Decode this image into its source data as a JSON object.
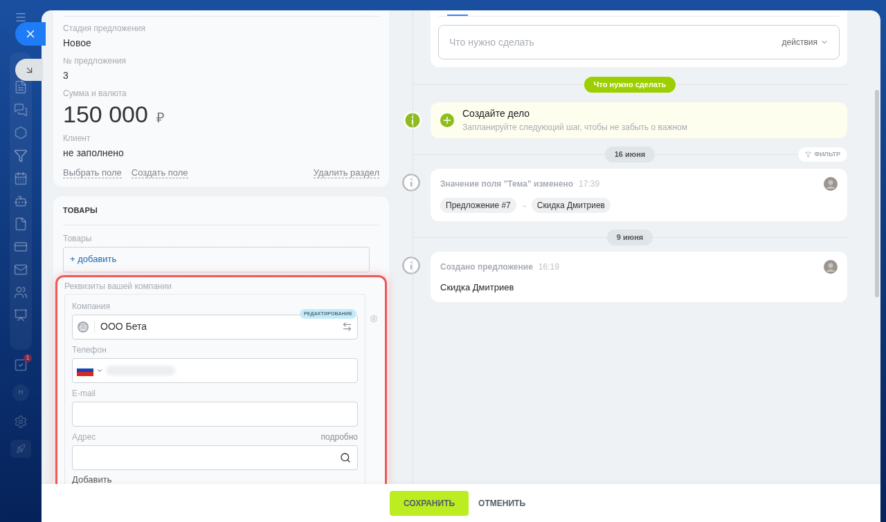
{
  "sidebar": {
    "task_badge": "1",
    "avatar_letter": "Н"
  },
  "details": {
    "fields": [
      {
        "label": "Стадия предложения",
        "value": "Новое",
        "kind": "text"
      },
      {
        "label": "№ предложения",
        "value": "3",
        "kind": "text"
      },
      {
        "label": "Сумма и валюта",
        "value": "150 000",
        "currency": "₽",
        "kind": "money"
      },
      {
        "label": "Клиент",
        "value": "не заполнено",
        "kind": "text"
      }
    ],
    "links": [
      "Выбрать поле",
      "Создать поле"
    ],
    "delete_link": "Удалить раздел"
  },
  "products": {
    "title": "ТОВАРЫ",
    "field_label": "Товары",
    "add_link": "+ добавить"
  },
  "requisites": {
    "title": "Реквизиты вашей компании",
    "highlighted": true,
    "company": {
      "label": "Компания",
      "value": "ООО Бета",
      "badge": "РЕДАКТИРОВАНИЕ"
    },
    "phone": {
      "label": "Телефон"
    },
    "email": {
      "label": "E-mail"
    },
    "address": {
      "label": "Адрес",
      "detail_link": "подробно"
    },
    "add_link": "Добавить"
  },
  "timeline": {
    "composer": {
      "placeholder": "Что нужно сделать",
      "actions": "действия"
    },
    "todo_marker": "Что нужно сделать",
    "todo": {
      "title": "Создайте дело",
      "subtitle": "Запланируйте следующий шаг, чтобы не забыть о важном"
    },
    "filter": "ФИЛЬТР",
    "groups": [
      {
        "date": "16 июня",
        "items": [
          {
            "kind": "change",
            "title": "Значение поля \"Тема\" изменено",
            "time": "17:39",
            "from": "Предложение #7",
            "arrow": "→",
            "to": "Скидка Дмитриев"
          }
        ]
      },
      {
        "date": "9 июня",
        "items": [
          {
            "kind": "created",
            "title": "Создано предложение",
            "time": "16:19",
            "text": "Скидка Дмитриев"
          }
        ]
      }
    ]
  },
  "footer": {
    "buttons": [
      {
        "label": "СОХРАНИТЬ",
        "kind": "primary"
      },
      {
        "label": "ОТМЕНИТЬ",
        "kind": "link"
      }
    ]
  }
}
